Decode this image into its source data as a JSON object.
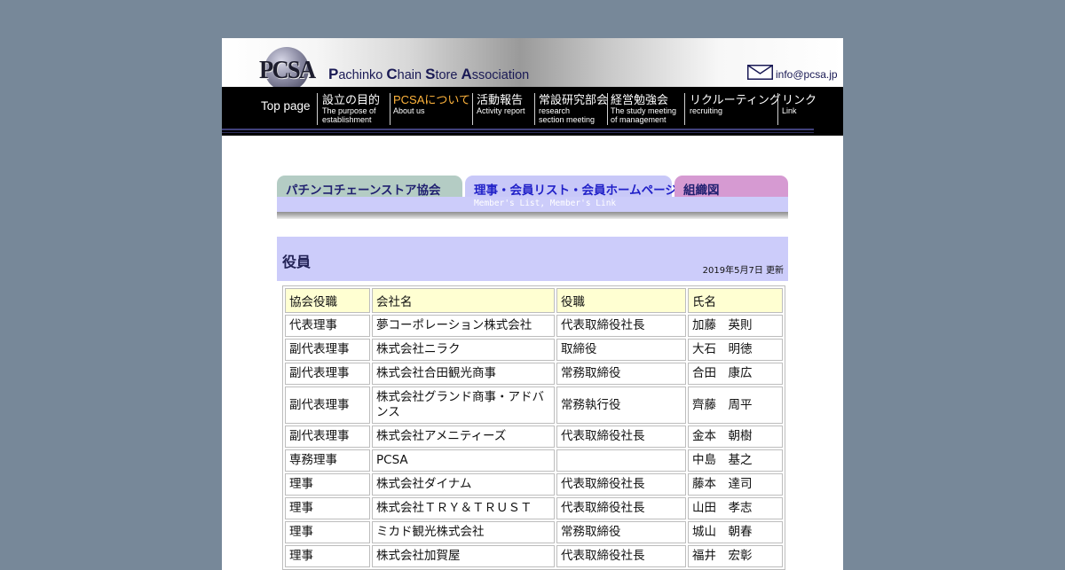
{
  "header": {
    "logo_text": "PCSA",
    "org_name": {
      "parts": [
        {
          "cap": "P",
          "rest": "achinko "
        },
        {
          "cap": "C",
          "rest": "hain "
        },
        {
          "cap": "S",
          "rest": "tore "
        },
        {
          "cap": "A",
          "rest": "ssociation"
        }
      ]
    },
    "email": "info@pcsa.jp"
  },
  "nav": {
    "top_page": "Top page",
    "items": [
      {
        "jp": "設立の目的",
        "en1": "The purpose of",
        "en2": "establishment"
      },
      {
        "jp": "PCSAについて",
        "en1": "About us",
        "en2": ""
      },
      {
        "jp": "活動報告",
        "en1": "Activity report",
        "en2": ""
      },
      {
        "jp": "常設研究部会",
        "en1": "research",
        "en2": "section meeting"
      },
      {
        "jp": "経営勉強会",
        "en1": "The study meeting",
        "en2": "of management"
      },
      {
        "jp": "リクルーティング",
        "en1": "recruiting",
        "en2": ""
      },
      {
        "jp": "リンク",
        "en1": "Link",
        "en2": ""
      }
    ]
  },
  "tabs": {
    "items": [
      {
        "label": "パチンコチェーンストア協会"
      },
      {
        "label": "理事・会員リスト・会員ホームページ"
      },
      {
        "label": "組織図"
      }
    ],
    "subtitle": "Member's List, Member's Link"
  },
  "section": {
    "title": "役員",
    "updated": "2019年5月7日 更新"
  },
  "table": {
    "headers": [
      "協会役職",
      "会社名",
      "役職",
      "氏名"
    ],
    "rows": [
      [
        "代表理事",
        "夢コーポレーション株式会社",
        "代表取締役社長",
        "加藤　英則"
      ],
      [
        "副代表理事",
        "株式会社ニラク",
        "取締役",
        "大石　明徳"
      ],
      [
        "副代表理事",
        "株式会社合田観光商事",
        "常務取締役",
        "合田　康広"
      ],
      [
        "副代表理事",
        "株式会社グランド商事・アドバンス",
        "常務執行役",
        "齊藤　周平"
      ],
      [
        "副代表理事",
        "株式会社アメニティーズ",
        "代表取締役社長",
        "金本　朝樹"
      ],
      [
        "専務理事",
        "PCSA",
        "",
        "中島　基之"
      ],
      [
        "理事",
        "株式会社ダイナム",
        "代表取締役社長",
        "藤本　達司"
      ],
      [
        "理事",
        "株式会社ＴＲＹ＆ＴＲＵＳＴ",
        "代表取締役社長",
        "山田　孝志"
      ],
      [
        "理事",
        "ミカド観光株式会社",
        "常務取締役",
        "城山　朝春"
      ],
      [
        "理事",
        "株式会社加賀屋",
        "代表取締役社長",
        "福井　宏彰"
      ]
    ]
  }
}
